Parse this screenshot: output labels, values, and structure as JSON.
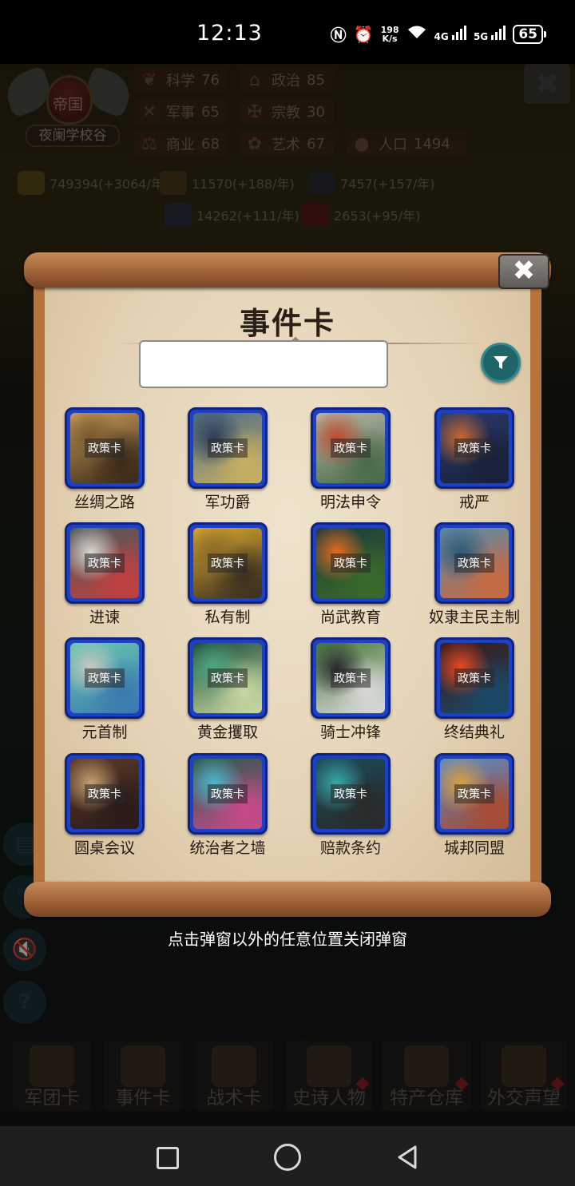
{
  "status_bar": {
    "time": "12:13",
    "speed_value": "198",
    "speed_unit": "K/s",
    "network_1": "4G",
    "network_2": "5G",
    "battery": "65"
  },
  "game": {
    "emblem_title": "帝国",
    "emblem_name": "夜阑学校谷",
    "stats": [
      {
        "label": "科学",
        "value": "76",
        "icon": "leaf-icon"
      },
      {
        "label": "政治",
        "value": "85",
        "icon": "temple-icon"
      },
      {
        "label": "军事",
        "value": "65",
        "icon": "crossed-swords-icon"
      },
      {
        "label": "宗教",
        "value": "30",
        "icon": "cross-icon"
      },
      {
        "label": "商业",
        "value": "68",
        "icon": "scales-icon"
      },
      {
        "label": "艺术",
        "value": "67",
        "icon": "lotus-icon"
      },
      {
        "label": "人口",
        "value": "1494",
        "icon": "person-icon"
      }
    ],
    "resources": [
      {
        "value": "749394(+3064/年)",
        "icon": "gold-icon"
      },
      {
        "value": "11570(+188/年)",
        "icon": "wood-icon"
      },
      {
        "value": "7457(+157/年)",
        "icon": "iron-icon"
      },
      {
        "value": "14262(+111/年)",
        "icon": "grain-icon"
      },
      {
        "value": "2653(+95/年)",
        "icon": "meat-icon"
      }
    ],
    "bottom_nav": [
      {
        "label": "军团卡",
        "dot": false
      },
      {
        "label": "事件卡",
        "dot": false
      },
      {
        "label": "战术卡",
        "dot": false
      },
      {
        "label": "史诗人物",
        "dot": true
      },
      {
        "label": "特产仓库",
        "dot": true
      },
      {
        "label": "外交声望",
        "dot": true
      }
    ]
  },
  "dialog": {
    "title": "事件卡",
    "close_label": "✖",
    "search_value": "",
    "search_placeholder": "",
    "card_tag": "政策卡",
    "cards": [
      {
        "name": "丝绸之路",
        "palette": [
          "#c89a58",
          "#7a5a30",
          "#3a2a18"
        ]
      },
      {
        "name": "军功爵",
        "palette": [
          "#4a6a88",
          "#2c3e58",
          "#c8b060"
        ]
      },
      {
        "name": "明法申令",
        "palette": [
          "#b8b8a8",
          "#c04a30",
          "#4a6a48"
        ]
      },
      {
        "name": "戒严",
        "palette": [
          "#2a3a6a",
          "#c86a30",
          "#18203a"
        ]
      },
      {
        "name": "进谏",
        "palette": [
          "#4a5a5a",
          "#d8d8d0",
          "#c04040"
        ]
      },
      {
        "name": "私有制",
        "palette": [
          "#d8a830",
          "#8a6a2a",
          "#3a3020"
        ]
      },
      {
        "name": "尚武教育",
        "palette": [
          "#1e3a3a",
          "#e86a20",
          "#3a6a2a"
        ]
      },
      {
        "name": "奴隶主民主制",
        "palette": [
          "#5a8aa8",
          "#2a5a78",
          "#c86a40"
        ]
      },
      {
        "name": "元首制",
        "palette": [
          "#6ac8b0",
          "#c8c8c0",
          "#3a7ab0"
        ]
      },
      {
        "name": "黄金攫取",
        "palette": [
          "#1a4a3a",
          "#4aa880",
          "#c8d8a0"
        ]
      },
      {
        "name": "骑士冲锋",
        "palette": [
          "#4a7a3a",
          "#2a2a30",
          "#d8d8d8"
        ]
      },
      {
        "name": "终结典礼",
        "palette": [
          "#3a1818",
          "#e84a20",
          "#1a4a6a"
        ]
      },
      {
        "name": "圆桌会议",
        "palette": [
          "#5a3a2a",
          "#c8a070",
          "#2a1a18"
        ]
      },
      {
        "name": "统治者之墙",
        "palette": [
          "#2a5a4a",
          "#4ab8d0",
          "#c84a8a"
        ]
      },
      {
        "name": "赔款条约",
        "palette": [
          "#1a4a5a",
          "#3aa8a8",
          "#2a2a2a"
        ]
      },
      {
        "name": "城邦同盟",
        "palette": [
          "#5a8ac8",
          "#d8a040",
          "#a84a30"
        ]
      }
    ]
  },
  "hint": "点击弹窗以外的任意位置关闭弹窗"
}
